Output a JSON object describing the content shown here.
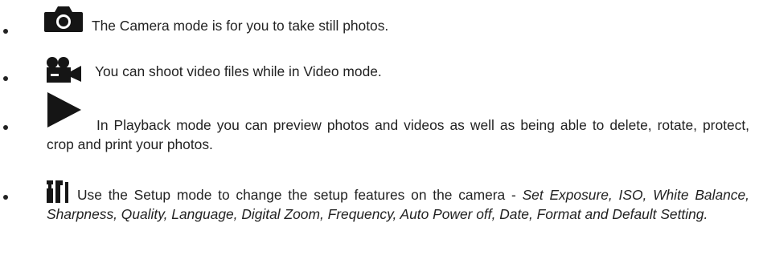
{
  "items": [
    {
      "icon": "camera-icon",
      "text": "The Camera mode is for you to take still photos."
    },
    {
      "icon": "video-camera-icon",
      "text": "You can shoot video files while in Video mode."
    },
    {
      "icon": "play-icon",
      "text": "In Playback mode you can preview photos and videos as well as being able to delete, rotate, protect, crop and print your photos."
    },
    {
      "icon": "setup-tools-icon",
      "text": "Use the Setup mode to change the setup features on the camera - ",
      "text_italic": "Set Exposure, ISO, White Balance, Sharpness, Quality, Language, Digital Zoom, Frequency, Auto Power off, Date, Format and Default Setting."
    }
  ]
}
